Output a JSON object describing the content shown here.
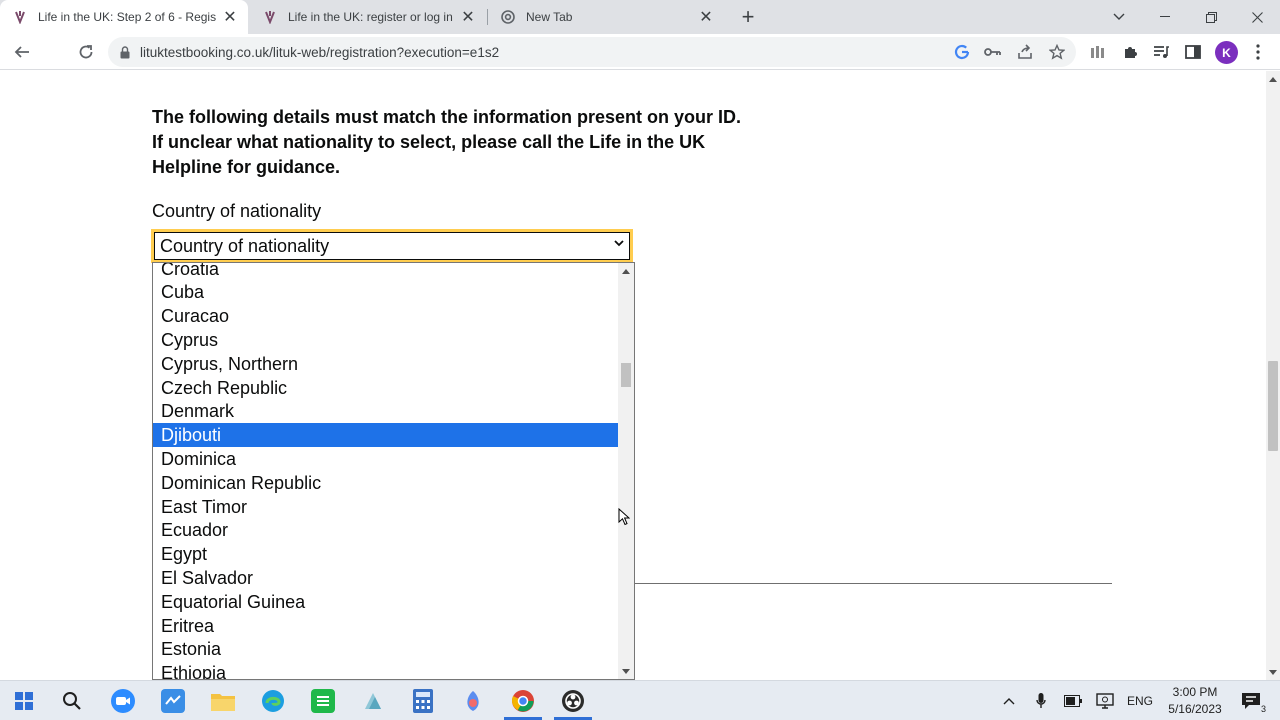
{
  "browser": {
    "tabs": [
      {
        "title": "Life in the UK: Step 2 of 6 - Regis",
        "active": true
      },
      {
        "title": "Life in the UK: register or log in",
        "active": false
      },
      {
        "title": "New Tab",
        "active": false
      }
    ],
    "url": "lituktestbooking.co.uk/lituk-web/registration?execution=e1s2",
    "avatar_letter": "K",
    "accent_color": "#1e72e8"
  },
  "page": {
    "notice_lines": [
      "The following details must match the information present on your ID.",
      "If unclear what nationality to select, please call the Life in the UK",
      "Helpline for guidance."
    ],
    "field_label": "Country of nationality",
    "select_value": "Country of nationality",
    "options": [
      "Croatia",
      "Cuba",
      "Curacao",
      "Cyprus",
      "Cyprus, Northern",
      "Czech Republic",
      "Denmark",
      "Djibouti",
      "Dominica",
      "Dominican Republic",
      "East Timor",
      "Ecuador",
      "Egypt",
      "El Salvador",
      "Equatorial Guinea",
      "Eritrea",
      "Estonia",
      "Ethiopia"
    ],
    "highlighted_option": "Djibouti"
  },
  "taskbar": {
    "language": "ENG",
    "time": "3:00 PM",
    "date": "5/16/2023",
    "notification_count": "3"
  }
}
